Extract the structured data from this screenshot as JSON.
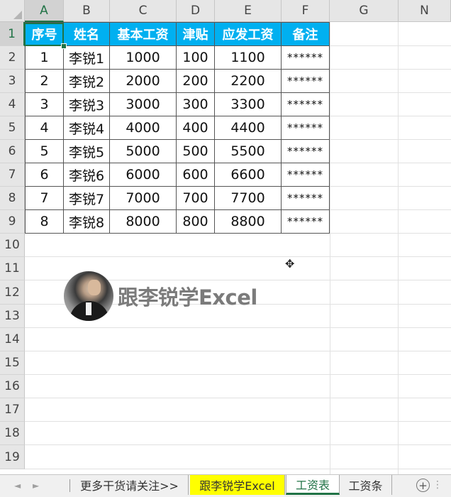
{
  "columns": [
    "A",
    "B",
    "C",
    "D",
    "E",
    "F",
    "G",
    "N"
  ],
  "rows": [
    "1",
    "2",
    "3",
    "4",
    "5",
    "6",
    "7",
    "8",
    "9",
    "10",
    "11",
    "12",
    "13",
    "14",
    "15",
    "16",
    "17",
    "18",
    "19"
  ],
  "table": {
    "headers": [
      "序号",
      "姓名",
      "基本工资",
      "津贴",
      "应发工资",
      "备注"
    ],
    "rows": [
      [
        "1",
        "李锐1",
        "1000",
        "100",
        "1100",
        "******"
      ],
      [
        "2",
        "李锐2",
        "2000",
        "200",
        "2200",
        "******"
      ],
      [
        "3",
        "李锐3",
        "3000",
        "300",
        "3300",
        "******"
      ],
      [
        "4",
        "李锐4",
        "4000",
        "400",
        "4400",
        "******"
      ],
      [
        "5",
        "李锐5",
        "5000",
        "500",
        "5500",
        "******"
      ],
      [
        "6",
        "李锐6",
        "6000",
        "600",
        "6600",
        "******"
      ],
      [
        "7",
        "李锐7",
        "7000",
        "700",
        "7700",
        "******"
      ],
      [
        "8",
        "李锐8",
        "8000",
        "800",
        "8800",
        "******"
      ]
    ]
  },
  "watermark": {
    "text": "跟李锐学Excel",
    "icon": "presenter-avatar-icon"
  },
  "sheet_tabs": [
    {
      "label": "更多干货请关注>>"
    },
    {
      "label": "跟李锐学Excel",
      "highlight": "#ffff00"
    },
    {
      "label": "工资表",
      "active": true
    },
    {
      "label": "工资条"
    }
  ],
  "tabbar": {
    "add_label": "+",
    "prev_arrow": "◄",
    "next_arrow": "►",
    "more": "⋮"
  },
  "colors": {
    "header_fill": "#00b0f0",
    "accent": "#217346"
  }
}
